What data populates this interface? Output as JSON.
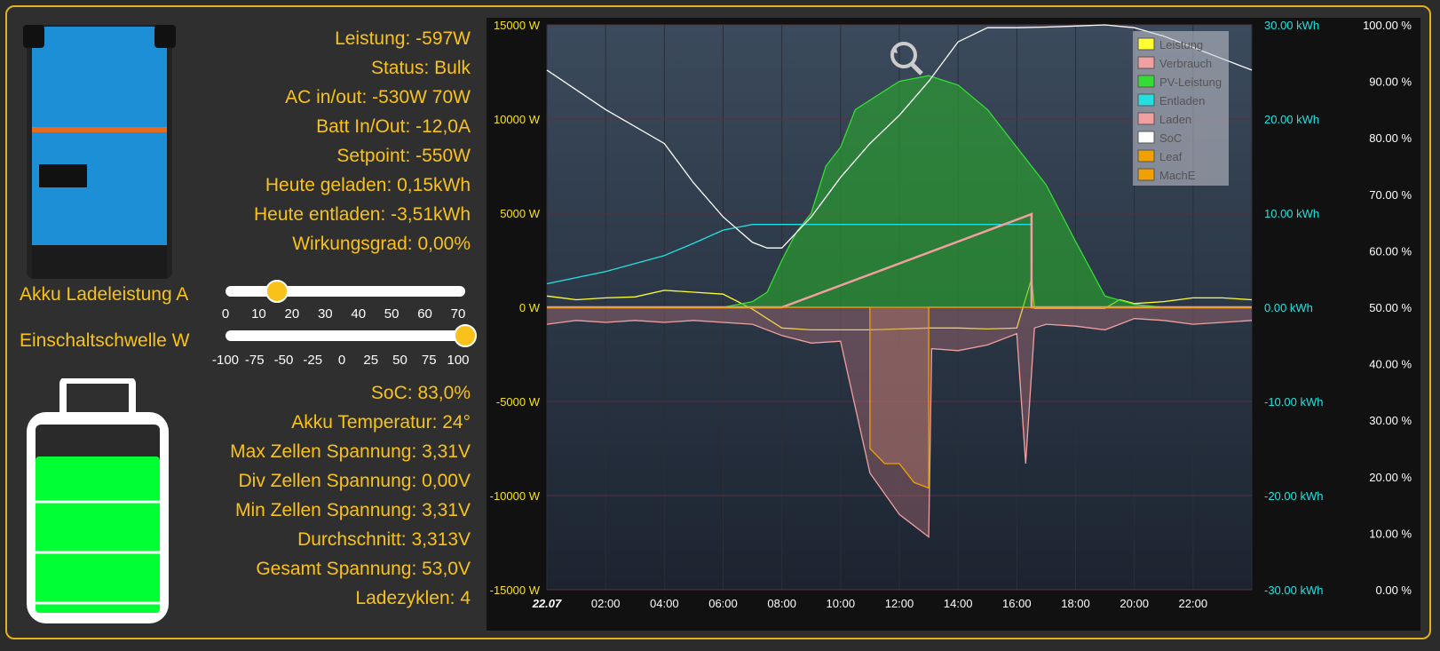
{
  "colors": {
    "accent": "#f8c21a",
    "battery_fill": "#00ff33",
    "pv": "#33dd33",
    "cyan": "#22e0e0"
  },
  "inverter": {
    "icon": "multiplus-ii-inverter-icon"
  },
  "stats_top": [
    "Leistung: -597W",
    "Status: Bulk",
    "AC in/out: -530W        70W",
    "Batt In/Out: -12,0A",
    "Setpoint: -550W",
    "Heute geladen: 0,15kWh",
    "Heute entladen: -3,51kWh",
    "Wirkungsgrad: 0,00%"
  ],
  "controls": {
    "charge_label": "Akku Ladeleistung A",
    "threshold_label": "Einschaltschwelle W",
    "charge_value": 15,
    "charge_ticks": [
      "0",
      "10",
      "20",
      "30",
      "40",
      "50",
      "60",
      "70"
    ],
    "threshold_value": 100,
    "threshold_ticks": [
      "-100",
      "-75",
      "-50",
      "-25",
      "0",
      "25",
      "50",
      "75",
      "100"
    ]
  },
  "battery": {
    "icon": "battery-icon",
    "soc": 0.83
  },
  "stats_bottom": [
    "SoC: 83,0%",
    "Akku Temperatur: 24°",
    "Max Zellen Spannung: 3,31V",
    "Div Zellen Spannung: 0,00V",
    "Min Zellen Spannung: 3,31V",
    "Durchschnitt: 3,313V",
    "Gesamt Spannung: 53,0V",
    "Ladezyklen: 4"
  ],
  "chart_data": {
    "type": "area",
    "zoom_icon": "zoom-reset-icon",
    "x_label_first": "22.07",
    "x_ticks": [
      "02:00",
      "04:00",
      "06:00",
      "08:00",
      "10:00",
      "12:00",
      "14:00",
      "16:00",
      "18:00",
      "20:00",
      "22:00"
    ],
    "y_left_ticks": [
      "15000 W",
      "10000 W",
      "5000 W",
      "0 W",
      "-5000 W",
      "-10000 W",
      "-15000 W"
    ],
    "y_left_range": [
      -15000,
      15000
    ],
    "y_mid_ticks": [
      "30.00 kWh",
      "20.00 kWh",
      "10.00 kWh",
      "0.00 kWh",
      "-10.00 kWh",
      "-20.00 kWh",
      "-30.00 kWh"
    ],
    "y_mid_range": [
      -30,
      30
    ],
    "y_right_ticks": [
      "100.00 %",
      "90.00 %",
      "80.00 %",
      "70.00 %",
      "60.00 %",
      "50.00 %",
      "40.00 %",
      "30.00 %",
      "20.00 %",
      "10.00 %",
      "0.00 %"
    ],
    "y_right_range": [
      0,
      100
    ],
    "legend_position": "top-right",
    "grid": true,
    "series": [
      {
        "name": "Leistung",
        "color": "#ffff33",
        "axis": "W",
        "points": [
          [
            0,
            600
          ],
          [
            1,
            400
          ],
          [
            2,
            500
          ],
          [
            3,
            550
          ],
          [
            4,
            900
          ],
          [
            5,
            800
          ],
          [
            6,
            700
          ],
          [
            7,
            -100
          ],
          [
            8,
            -1100
          ],
          [
            9,
            -1200
          ],
          [
            10,
            -1200
          ],
          [
            11,
            -1200
          ],
          [
            12,
            -1150
          ],
          [
            13,
            -1100
          ],
          [
            14,
            -1100
          ],
          [
            15,
            -1150
          ],
          [
            16,
            -1100
          ],
          [
            16.5,
            1500
          ],
          [
            16.6,
            -50
          ],
          [
            18,
            -50
          ],
          [
            19,
            -50
          ],
          [
            19.5,
            400
          ],
          [
            20,
            200
          ],
          [
            21,
            300
          ],
          [
            22,
            500
          ],
          [
            23,
            500
          ],
          [
            24,
            400
          ]
        ]
      },
      {
        "name": "Verbrauch",
        "color": "#f0a0a0",
        "axis": "W",
        "points": [
          [
            0,
            -900
          ],
          [
            1,
            -700
          ],
          [
            2,
            -800
          ],
          [
            3,
            -700
          ],
          [
            4,
            -800
          ],
          [
            5,
            -700
          ],
          [
            6,
            -800
          ],
          [
            7,
            -900
          ],
          [
            8,
            -1500
          ],
          [
            9,
            -1900
          ],
          [
            10,
            -1800
          ],
          [
            11,
            -8800
          ],
          [
            12,
            -11000
          ],
          [
            13,
            -12200
          ],
          [
            13.1,
            -2200
          ],
          [
            14,
            -2300
          ],
          [
            15,
            -2000
          ],
          [
            16,
            -1400
          ],
          [
            16.3,
            -8300
          ],
          [
            16.6,
            -1100
          ],
          [
            17,
            -900
          ],
          [
            18,
            -1000
          ],
          [
            19,
            -1200
          ],
          [
            20,
            -600
          ],
          [
            21,
            -700
          ],
          [
            22,
            -900
          ],
          [
            23,
            -800
          ],
          [
            24,
            -700
          ]
        ]
      },
      {
        "name": "PV-Leistung",
        "color": "#33dd33",
        "axis": "W",
        "points": [
          [
            0,
            0
          ],
          [
            6,
            0
          ],
          [
            7,
            300
          ],
          [
            7.5,
            800
          ],
          [
            8,
            2500
          ],
          [
            8.5,
            4000
          ],
          [
            9,
            5000
          ],
          [
            9.5,
            7500
          ],
          [
            10,
            8500
          ],
          [
            10.5,
            10500
          ],
          [
            11,
            11000
          ],
          [
            12,
            12000
          ],
          [
            13,
            12300
          ],
          [
            14,
            11800
          ],
          [
            15,
            10500
          ],
          [
            16,
            8500
          ],
          [
            17,
            6500
          ],
          [
            18,
            3500
          ],
          [
            19,
            600
          ],
          [
            20,
            150
          ],
          [
            21,
            0
          ],
          [
            24,
            0
          ]
        ]
      },
      {
        "name": "Entladen",
        "color": "#22e0e0",
        "axis": "kWh",
        "points": [
          [
            0,
            2.5
          ],
          [
            2,
            3.8
          ],
          [
            4,
            5.5
          ],
          [
            5,
            6.8
          ],
          [
            6,
            8.2
          ],
          [
            7,
            8.8
          ],
          [
            8,
            8.8
          ],
          [
            12,
            8.8
          ],
          [
            16.5,
            8.8
          ]
        ]
      },
      {
        "name": "Laden",
        "color": "#f0a0a0",
        "axis": "kWh",
        "points": [
          [
            0,
            0
          ],
          [
            8,
            0
          ],
          [
            16.5,
            9.9
          ],
          [
            16.5,
            0
          ],
          [
            24,
            0
          ]
        ]
      },
      {
        "name": "SoC",
        "color": "#ffffff",
        "axis": "%",
        "points": [
          [
            0,
            92
          ],
          [
            2,
            85
          ],
          [
            4,
            79
          ],
          [
            5,
            72
          ],
          [
            6,
            66
          ],
          [
            7,
            61.5
          ],
          [
            7.5,
            60.5
          ],
          [
            8,
            60.5
          ],
          [
            9,
            66
          ],
          [
            10,
            73
          ],
          [
            11,
            79
          ],
          [
            12,
            84
          ],
          [
            13,
            90
          ],
          [
            14,
            97
          ],
          [
            15,
            99.5
          ],
          [
            16,
            99.5
          ],
          [
            17,
            99.6
          ],
          [
            18,
            99.8
          ],
          [
            19,
            100
          ],
          [
            20,
            99.5
          ],
          [
            21,
            98
          ],
          [
            22,
            96
          ],
          [
            23,
            94
          ],
          [
            24,
            92
          ]
        ]
      },
      {
        "name": "Leaf",
        "color": "#f0a000",
        "axis": "W",
        "points": [
          [
            0,
            0
          ],
          [
            11,
            0
          ],
          [
            11,
            -7500
          ],
          [
            11.5,
            -8300
          ],
          [
            12,
            -8300
          ],
          [
            12.5,
            -9300
          ],
          [
            13,
            -9600
          ],
          [
            13,
            0
          ],
          [
            24,
            0
          ]
        ]
      },
      {
        "name": "MachE",
        "color": "#f0a000",
        "axis": "W",
        "points": [
          [
            0,
            0
          ],
          [
            24,
            0
          ]
        ]
      }
    ]
  }
}
